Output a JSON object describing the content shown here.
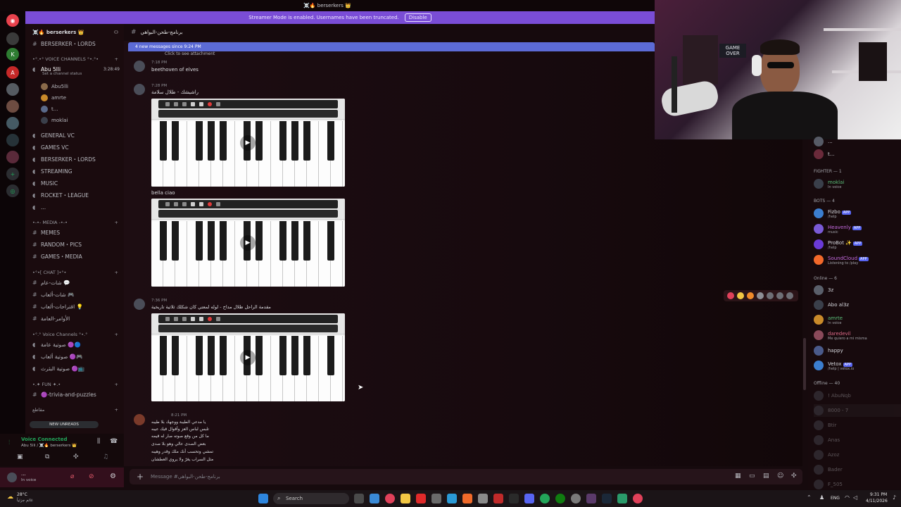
{
  "window": {
    "title": "☠️🔥 berserkers 👑"
  },
  "banner": {
    "text": "Streamer Mode is enabled. Usernames have been truncated.",
    "disable_label": "Disable"
  },
  "server": {
    "name": "☠️🔥 berserkers 👑"
  },
  "sidebar": {
    "top_channel": "BERSERKER・LORDS",
    "voice_category": "•°.•° VOICE CHANNELS °•.°•",
    "active_vc": {
      "name": "Abu 5lli",
      "status": "Set a channel status",
      "timer": "3:28:49"
    },
    "vc_users": [
      "Abu5lli",
      "amrte",
      "t...",
      "moklai"
    ],
    "channels": [
      {
        "kind": "voice",
        "label": "GENERAL VC"
      },
      {
        "kind": "voice",
        "label": "GAMES VC"
      },
      {
        "kind": "text",
        "label": "BERSERKER・LORDS"
      },
      {
        "kind": "voice",
        "label": "STREAMING"
      },
      {
        "kind": "voice",
        "label": "MUSIC"
      },
      {
        "kind": "voice",
        "label": "ROCKET・LEAGUE"
      },
      {
        "kind": "voice",
        "label": "..."
      }
    ],
    "media_category": "•-•- MEDIA -•-•",
    "media_channels": [
      "MEMES",
      "RANDOM・PICS",
      "GAMES・MEDIA"
    ],
    "chat_category": "•°•[ CHAT ]•°•",
    "chat_channels": [
      "شات-عام 💬",
      "شات-ألعاب 🎮",
      "اقتراحات-ألعاب 💡",
      "الأوامر-العامة"
    ],
    "voice2_category": "•°.° Voice Channels °•.°",
    "voice2_channels": [
      "صوتية عامة 🟣🔵",
      "صوتية ألعاب 🟣🎮",
      "صوتية البثرث 🟣📺"
    ],
    "fun_category": "•.✦ FUN ✦.•",
    "fun_channels": [
      "🟣-trivia-and-puzzles"
    ],
    "bottom_category": "مقاطع",
    "new_unreads": "NEW UNREADS"
  },
  "voice_panel": {
    "status": "Voice Connected",
    "location": "Abu 5lli / ☠️🔥 berserkers 👑"
  },
  "user_panel": {
    "name": "...",
    "status": "In voice"
  },
  "chat": {
    "channel_name": "برنامج-طحن-البواهي",
    "new_messages": "4 new messages since 9:24 PM",
    "click_attachment": "Click to see attachment",
    "messages": [
      {
        "time": "7:18 PM",
        "text": "beethoven of elves"
      },
      {
        "time": "7:28 PM",
        "text": "راشيشك - طلال سلامة"
      },
      {
        "caption": "bella ciao"
      },
      {
        "time": "7:36 PM",
        "text": "مقدمة الراحل طلال مداح - لوله لمعتي كان شكلك ثلاثية تاريخية"
      },
      {
        "time": "8:21 PM",
        "lines": [
          "يا مدعي الطيبة ووجهك بلا طيبه",
          "تلبس لباس العز وأقوال قيك عيبه",
          "ما كل من وقع صوته صار له قيمه",
          "بعض الصدى عالي وهو بلا صدى",
          "تمشي وتحسب أنك ملك وقدر وهيبه",
          "مثل السراب يغرّ ولا يروي العطشان"
        ]
      }
    ],
    "input_placeholder": "Message #برنامج-طحن-البواهي"
  },
  "members": {
    "top_partial": [
      "...",
      "t..."
    ],
    "fighter_category": "FIGHTER — 1",
    "fighter": [
      {
        "name": "moklai",
        "status": "In voice"
      }
    ],
    "bots_category": "BOTS — 4",
    "bots": [
      {
        "name": "Fizbo",
        "tag": "APP",
        "status": "/help"
      },
      {
        "name": "Heavenly",
        "tag": "APP",
        "status": "music"
      },
      {
        "name": "ProBot ✨",
        "tag": "APP",
        "status": "/help"
      },
      {
        "name": "SoundCloud",
        "tag": "APP",
        "status": "Listening to /play"
      }
    ],
    "online_category": "Online — 6",
    "online": [
      {
        "name": "3z",
        "status": ""
      },
      {
        "name": "Abo al3z",
        "status": ""
      },
      {
        "name": "amrte",
        "status": "In voice"
      },
      {
        "name": "daredevil",
        "status": "Me quiero a mi misma"
      },
      {
        "name": "happy",
        "status": ""
      },
      {
        "name": "Vetox",
        "tag": "APP",
        "status": "/help | vetox.io"
      }
    ],
    "offline_category": "Offline — 40",
    "offline": [
      "! AbuNqb",
      "8000 - 7",
      "Btir",
      "Anas",
      "Azoz",
      "Bader",
      "F_505"
    ]
  },
  "webcam": {
    "sign": "GAME OVER"
  },
  "taskbar": {
    "weather": "28°C",
    "weather_sub": "غائم جزئياً",
    "search_label": "Search",
    "lang": "ENG",
    "time": "9:31 PM",
    "date": "4/11/2026"
  },
  "colors": {
    "accent": "#5865f2",
    "banner": "#7a4dd6",
    "new_msgs_bar": "#5c6bd6",
    "online_green": "#23a55a"
  }
}
